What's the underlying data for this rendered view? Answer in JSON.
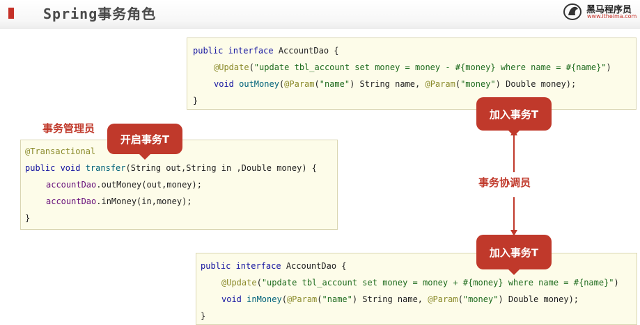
{
  "header": {
    "title": "Spring事务角色",
    "logo_name": "黑马程序员",
    "logo_url": "www.itheima.com"
  },
  "colors": {
    "accent_red": "#c0392b",
    "code_background": "#fdfce9",
    "keyword": "#1414a0",
    "annotation": "#8a8a2a",
    "string": "#1e6b1e"
  },
  "code_top": {
    "line1": {
      "kw": "public interface ",
      "rest": "AccountDao {"
    },
    "line2": {
      "ann": "@Update",
      "p1": "(",
      "str": "\"update tbl_account set money = money - #{money} where name = #{name}\"",
      "p2": ")"
    },
    "line3": {
      "kw": "void ",
      "mth": "outMoney",
      "p1": "(",
      "ann1": "@Param",
      "p2": "(",
      "str1": "\"name\"",
      "p3": ") String name, ",
      "ann2": "@Param",
      "p4": "(",
      "str2": "\"money\"",
      "p5": ") Double money);"
    },
    "line4": "}"
  },
  "code_mid": {
    "line1": "@Transactional",
    "line2": {
      "kw": "public void ",
      "mth": "transfer",
      "rest": "(String out,String in ,Double money) {"
    },
    "line3": {
      "fld": "accountDao",
      "rest": ".outMoney(out,money);"
    },
    "line4": {
      "fld": "accountDao",
      "rest": ".inMoney(in,money);"
    },
    "line5": "}"
  },
  "code_bottom": {
    "line1": {
      "kw": "public interface ",
      "rest": "AccountDao {"
    },
    "line2": {
      "ann": "@Update",
      "p1": "(",
      "str": "\"update tbl_account set money = money + #{money} where name = #{name}\"",
      "p2": ")"
    },
    "line3": {
      "kw": "void ",
      "mth": "inMoney",
      "p1": "(",
      "ann1": "@Param",
      "p2": "(",
      "str1": "\"name\"",
      "p3": ") String name, ",
      "ann2": "@Param",
      "p4": "(",
      "str2": "\"money\"",
      "p5": ") Double money);"
    },
    "line4": "}"
  },
  "labels": {
    "manager": "事务管理员",
    "coordinator": "事务协调员",
    "start_transaction": "开启事务T",
    "join_transaction_top": "加入事务T",
    "join_transaction_bottom": "加入事务T"
  }
}
